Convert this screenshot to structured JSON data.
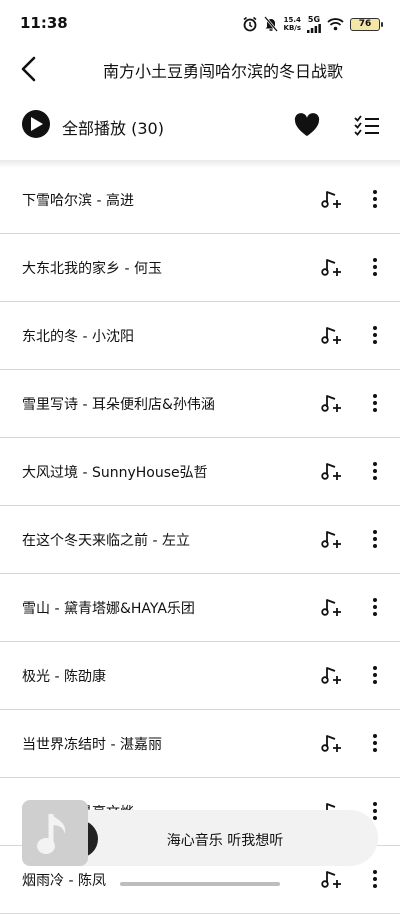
{
  "status": {
    "time": "11:38",
    "net_speed_value": "15.4",
    "net_speed_unit": "KB/s",
    "network": "5G",
    "battery": "76"
  },
  "header": {
    "title": "南方小土豆勇闯哈尔滨的冬日战歌"
  },
  "playbar": {
    "play_all": "全部播放 (30)"
  },
  "songs": [
    {
      "text": "下雪哈尔滨 - 高进"
    },
    {
      "text": "大东北我的家乡 - 何玉"
    },
    {
      "text": "东北的冬 - 小沈阳"
    },
    {
      "text": "雪里写诗 - 耳朵便利店&孙伟涵"
    },
    {
      "text": "大风过境 - SunnyHouse弘哲"
    },
    {
      "text": "在这个冬天来临之前 - 左立"
    },
    {
      "text": "雪山 - 黛青塔娜&HAYA乐团"
    },
    {
      "text": "极光 - 陈劭康"
    },
    {
      "text": "当世界冻结时 - 湛嘉丽"
    },
    {
      "text": "初雪 - 戴景豪文烨"
    },
    {
      "text": "烟雨冷 - 陈凤"
    }
  ],
  "mini_player": {
    "text": "海心音乐 听我想听"
  },
  "icons": {
    "back": "back-arrow-icon",
    "play": "play-icon",
    "favorite": "heart-icon",
    "queue": "checklist-icon",
    "add": "add-to-playlist-icon",
    "more": "more-vertical-icon",
    "cover": "music-note-icon"
  }
}
